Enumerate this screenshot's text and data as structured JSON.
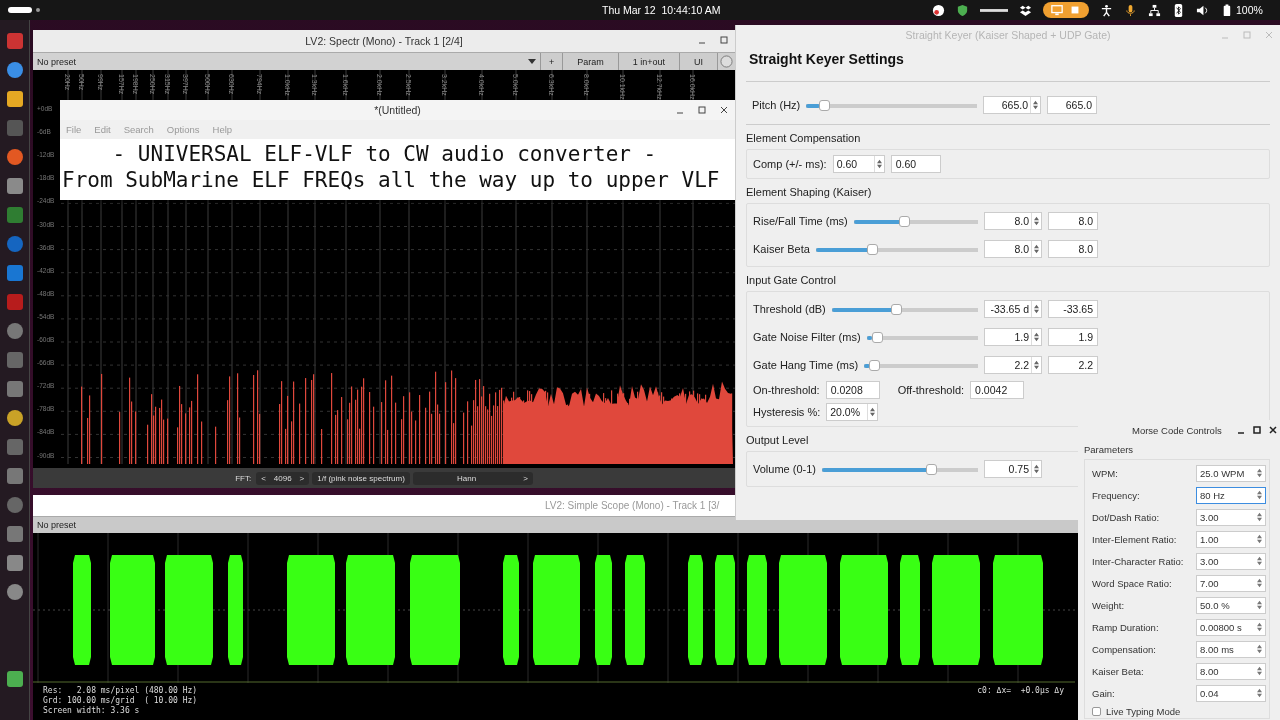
{
  "top_bar": {
    "date_time": "Thu Mar 12  10:44:10 AM",
    "battery": "100%"
  },
  "spectr_window": {
    "title": "LV2: Spectr (Mono) - Track 1 [2/4]",
    "preset": "No preset",
    "buttons": [
      "+",
      "Param",
      "1 in+out",
      "UI"
    ],
    "freq_labels": [
      "20Hz",
      "50Hz",
      "99Hz",
      "157Hz",
      "198Hz",
      "250Hz",
      "315Hz",
      "397Hz",
      "500Hz",
      "630Hz",
      "794Hz",
      "1.0kHz",
      "1.3kHz",
      "1.6kHz",
      "2.0kHz",
      "2.5kHz",
      "3.2kHz",
      "4.0kHz",
      "5.0kHz",
      "6.3kHz",
      "8.0kHz",
      "10.1kHz",
      "12.7kHz",
      "16.0kHz"
    ],
    "db_labels": [
      "+0dB",
      "-6dB",
      "-12dB",
      "-18dB",
      "-24dB",
      "-30dB",
      "-36dB",
      "-42dB",
      "-48dB",
      "-54dB",
      "-60dB",
      "-66dB",
      "-72dB",
      "-78dB",
      "-84dB",
      "-90dB"
    ],
    "fft_label": "FFT:",
    "fft_prev": "<",
    "fft_size": "4096",
    "fft_next": ">",
    "weighting": "1/f (pink noise spectrum)",
    "window_fn": "Hann",
    "window_next": ">"
  },
  "editor_window": {
    "title": "*(Untitled)",
    "menu": [
      "File",
      "Edit",
      "Search",
      "Options",
      "Help"
    ],
    "lines": [
      "    - UNIVERSAL ELF-VLF to CW audio converter -",
      "From SubMarine ELF FREQs all the way up to upper VLF"
    ]
  },
  "scope_window": {
    "title": "LV2: Simple Scope (Mono) - Track 1 [3/",
    "preset": "No preset",
    "info": [
      "Res:   2.08 ms/pixel (480.00 Hz)",
      "Grd: 100.00 ms/grid  ( 10.00 Hz)",
      "Screen width: 3.36 s"
    ],
    "cursor_info": "c0: Δx=  +0.0µs Δy"
  },
  "keyer_window": {
    "title": "Straight Keyer (Kaiser Shaped + UDP Gate)",
    "heading": "Straight Keyer Settings",
    "sections": [
      {
        "rows": [
          {
            "kind": "slider",
            "label": "Pitch (Hz)",
            "level": 0.08,
            "spin": "665.0",
            "value": "665.0"
          }
        ]
      },
      {
        "heading": "Element Compensation",
        "rows": [
          {
            "kind": "spin",
            "label": "Comp (+/- ms):",
            "spin": "0.60",
            "value": "0.60"
          }
        ]
      },
      {
        "heading": "Element Shaping (Kaiser)",
        "rows": [
          {
            "kind": "slider",
            "label": "Rise/Fall Time (ms)",
            "level": 0.4,
            "spin": "8.0",
            "value": "8.0"
          },
          {
            "kind": "slider",
            "label": "Kaiser Beta",
            "level": 0.34,
            "spin": "8.0",
            "value": "8.0"
          }
        ]
      },
      {
        "heading": "Input Gate Control",
        "rows": [
          {
            "kind": "slider",
            "label": "Threshold (dB)",
            "level": 0.44,
            "spin": "-33.65 d",
            "value": "-33.65"
          },
          {
            "kind": "slider",
            "label": "Gate Noise Filter (ms)",
            "level": 0.05,
            "spin": "1.9",
            "value": "1.9"
          },
          {
            "kind": "slider",
            "label": "Gate Hang Time (ms)",
            "level": 0.05,
            "spin": "2.2",
            "value": "2.2"
          },
          {
            "kind": "pair",
            "label": "On-threshold:",
            "value": "0.0208",
            "label2": "Off-threshold:",
            "value2": "0.0042"
          },
          {
            "kind": "spin",
            "label": "Hysteresis %:",
            "spin": "20.0%"
          }
        ]
      },
      {
        "heading": "Output Level",
        "rows": [
          {
            "kind": "slider",
            "label": "Volume (0-1)",
            "level": 0.72,
            "spin": "0.75"
          }
        ]
      }
    ]
  },
  "morse_window": {
    "title": "Morse Code Controls",
    "group": "Parameters",
    "params": [
      {
        "label": "WPM:",
        "value": "25.0 WPM",
        "focused": false
      },
      {
        "label": "Frequency:",
        "value": "80 Hz",
        "focused": true
      },
      {
        "label": "Dot/Dash Ratio:",
        "value": "3.00",
        "focused": false
      },
      {
        "label": "Inter-Element Ratio:",
        "value": "1.00",
        "focused": false
      },
      {
        "label": "Inter-Character Ratio:",
        "value": "3.00",
        "focused": false
      },
      {
        "label": "Word Space Ratio:",
        "value": "7.00",
        "focused": false
      },
      {
        "label": "Weight:",
        "value": "50.0 %",
        "focused": false
      },
      {
        "label": "Ramp Duration:",
        "value": "0.00800 s",
        "focused": false
      },
      {
        "label": "Compensation:",
        "value": "8.00 ms",
        "focused": false
      },
      {
        "label": "Kaiser Beta:",
        "value": "8.00",
        "focused": false
      },
      {
        "label": "Gain:",
        "value": "0.04",
        "focused": false
      }
    ],
    "live_typing": {
      "label": "Live Typing Mode",
      "checked": false
    }
  }
}
